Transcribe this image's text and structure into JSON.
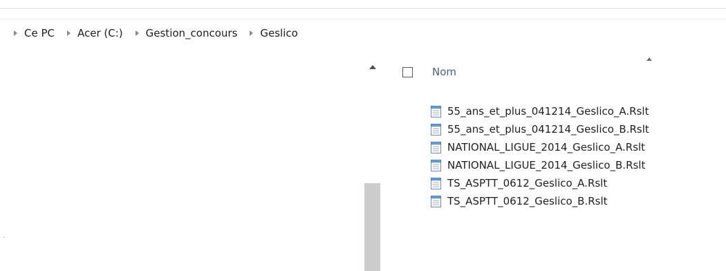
{
  "breadcrumb": {
    "items": [
      "Ce PC",
      "Acer (C:)",
      "Gestion_concours",
      "Geslico"
    ]
  },
  "file_list": {
    "column_header": "Nom",
    "sort": "ascending",
    "files": [
      "55_ans_et_plus_041214_Geslico_A.Rslt",
      "55_ans_et_plus_041214_Geslico_B.Rslt",
      "NATIONAL_LIGUE_2014_Geslico_A.Rslt",
      "NATIONAL_LIGUE_2014_Geslico_B.Rslt",
      "TS_ASPTT_0612_Geslico_A.Rslt",
      "TS_ASPTT_0612_Geslico_B.Rslt"
    ],
    "file_icon": "notepad-document-icon"
  },
  "colors": {
    "column_header": "#4c607a",
    "scroll_thumb": "#cdcdcd",
    "file_icon_accent": "#6aa6d8"
  }
}
